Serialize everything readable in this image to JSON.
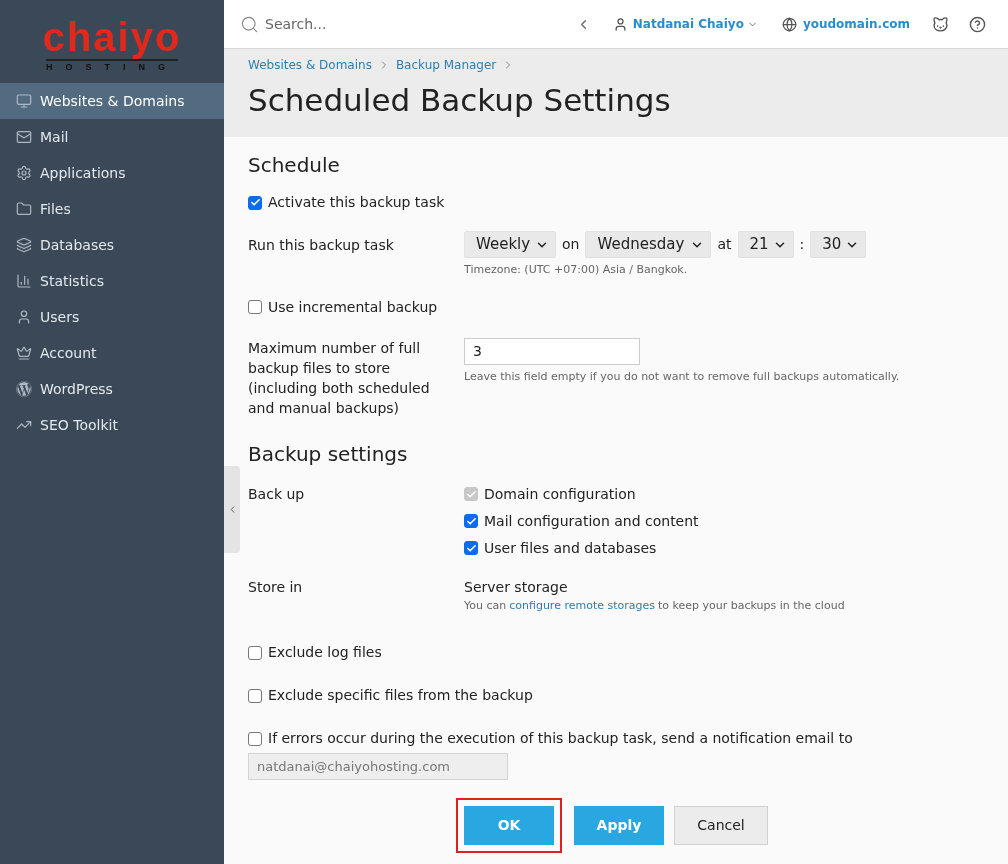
{
  "logo": {
    "brand": "chaiyo",
    "tagline": "HOSTING"
  },
  "sidebar": {
    "items": [
      {
        "label": "Websites & Domains",
        "selected": true
      },
      {
        "label": "Mail",
        "selected": false
      },
      {
        "label": "Applications",
        "selected": false
      },
      {
        "label": "Files",
        "selected": false
      },
      {
        "label": "Databases",
        "selected": false
      },
      {
        "label": "Statistics",
        "selected": false
      },
      {
        "label": "Users",
        "selected": false
      },
      {
        "label": "Account",
        "selected": false
      },
      {
        "label": "WordPress",
        "selected": false
      },
      {
        "label": "SEO Toolkit",
        "selected": false
      }
    ]
  },
  "header": {
    "search_placeholder": "Search...",
    "user": "Natdanai Chaiyo",
    "domain": "youdomain.com"
  },
  "breadcrumbs": [
    "Websites & Domains",
    "Backup Manager"
  ],
  "page_title": "Scheduled Backup Settings",
  "schedule": {
    "heading": "Schedule",
    "activate": {
      "label": "Activate this backup task",
      "checked": true
    },
    "run_label": "Run this backup task",
    "frequency": "Weekly",
    "on_text": "on",
    "day": "Wednesday",
    "at_text": "at",
    "hour": "21",
    "colon": ":",
    "minute": "30",
    "timezone": "Timezone: (UTC +07:00) Asia / Bangkok.",
    "incremental": {
      "label": "Use incremental backup",
      "checked": false
    },
    "max_label": "Maximum number of full backup files to store (including both scheduled and manual backups)",
    "max_value": "3",
    "max_hint": "Leave this field empty if you do not want to remove full backups automatically."
  },
  "backup_settings": {
    "heading": "Backup settings",
    "backup_label": "Back up",
    "items": [
      {
        "label": "Domain configuration",
        "checked": true,
        "disabled": true
      },
      {
        "label": "Mail configuration and content",
        "checked": true,
        "disabled": false
      },
      {
        "label": "User files and databases",
        "checked": true,
        "disabled": false
      }
    ],
    "store_label": "Store in",
    "store_value": "Server storage",
    "store_hint_before": "You can",
    "store_link": "configure remote storages",
    "store_hint_after": "to keep your backups in the cloud",
    "options": [
      {
        "label": "Exclude log files",
        "checked": false
      },
      {
        "label": "Exclude specific files from the backup",
        "checked": false
      },
      {
        "label": "If errors occur during the execution of this backup task, send a notification email to",
        "checked": false
      }
    ],
    "email": "natdanai@chaiyohosting.com"
  },
  "buttons": [
    {
      "label": "OK",
      "kind": "primary",
      "highlighted": true
    },
    {
      "label": "Apply",
      "kind": "primary",
      "highlighted": false
    },
    {
      "label": "Cancel",
      "kind": "secondary",
      "highlighted": false
    }
  ]
}
